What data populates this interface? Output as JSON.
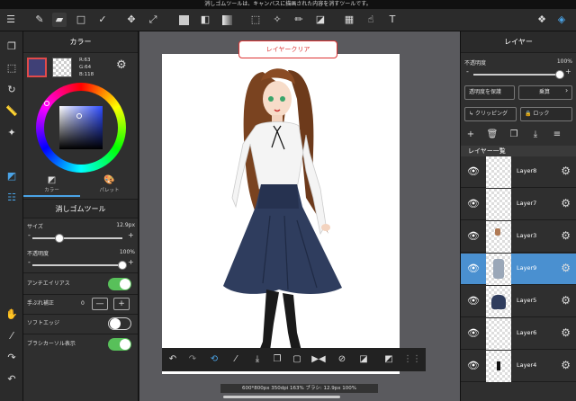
{
  "top_message": "消しゴムツールは、キャンバスに描画された内容を消すツールです。",
  "color_panel": {
    "title": "カラー",
    "rgb": {
      "r": "R:63",
      "g": "G:64",
      "b": "B:118"
    },
    "main_color": "#3f4076",
    "tabs": [
      {
        "label": "カラー"
      },
      {
        "label": "パレット"
      }
    ]
  },
  "tool_panel": {
    "title": "消しゴムツール",
    "size_label": "サイズ",
    "size_value": "12.9px",
    "size_fraction": 0.3,
    "opacity_label": "不透明度",
    "opacity_value": "100%",
    "opacity_fraction": 1.0,
    "antialias_label": "アンチエイリアス",
    "antialias_on": true,
    "stabilizer_label": "手ぶれ補正",
    "stabilizer_value": "0",
    "minus": "—",
    "plus": "+",
    "soft_edge_label": "ソフトエッジ",
    "soft_edge_on": false,
    "brush_cursor_label": "ブラシカーソル表示",
    "brush_cursor_on": true
  },
  "canvas": {
    "clear_button": "レイヤークリア",
    "status": "600*800px 350dpi 163% ブラシ: 12.9px 100%"
  },
  "layer_panel": {
    "title": "レイヤー",
    "opacity_label": "不透明度",
    "opacity_value": "100%",
    "protect_label": "透明度を保護",
    "blend_label": "乗算",
    "clipping_label": "クリッピング",
    "lock_label": "ロック",
    "list_title": "レイヤー一覧",
    "layers": [
      {
        "name": "Layer8",
        "selected": false
      },
      {
        "name": "Layer7",
        "selected": false
      },
      {
        "name": "Layer3",
        "selected": false
      },
      {
        "name": "Layer9",
        "selected": true
      },
      {
        "name": "Layer5",
        "selected": false
      },
      {
        "name": "Layer6",
        "selected": false
      },
      {
        "name": "Layer4",
        "selected": false
      }
    ]
  }
}
